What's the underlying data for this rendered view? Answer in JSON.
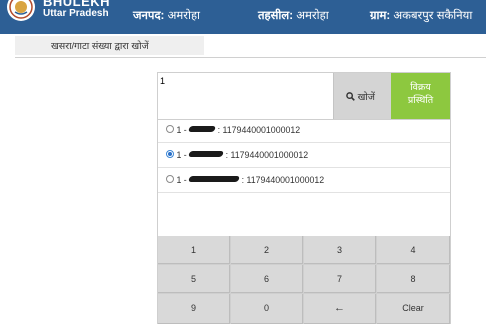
{
  "header": {
    "brand_title": "BHULEKH",
    "brand_subtitle": "Uttar Pradesh",
    "district_label": "जनपद:",
    "district_value": "अमरोहा",
    "tehsil_label": "तहसील:",
    "tehsil_value": "अमरोहा",
    "village_label": "ग्राम:",
    "village_value": "अकबरपुर सकैनिया"
  },
  "tab": {
    "label": "खसरा/गाटा संख्या द्वारा खोजें"
  },
  "search": {
    "input_value": "1",
    "search_button_label": "खोजें",
    "sale_button_line1": "विक्रय",
    "sale_button_line2": "प्रस्थिति"
  },
  "results": [
    {
      "prefix": "1 -",
      "code": "1179440001000012",
      "selected": false
    },
    {
      "prefix": "1 -",
      "code": "1179440001000012",
      "selected": true
    },
    {
      "prefix": "1 -",
      "code": "1179440001000012",
      "selected": false
    }
  ],
  "keypad": [
    "1",
    "2",
    "3",
    "4",
    "5",
    "6",
    "7",
    "8",
    "9",
    "0",
    "←",
    "Clear"
  ],
  "colors": {
    "header_bg": "#2d5f95",
    "sale_button": "#8dc83f",
    "search_button": "#d4d4d4",
    "keypad_bg": "#d9d9d9"
  },
  "icons": {
    "logo": "government-emblem-logo",
    "search": "search-icon",
    "backspace": "left-arrow-icon"
  }
}
